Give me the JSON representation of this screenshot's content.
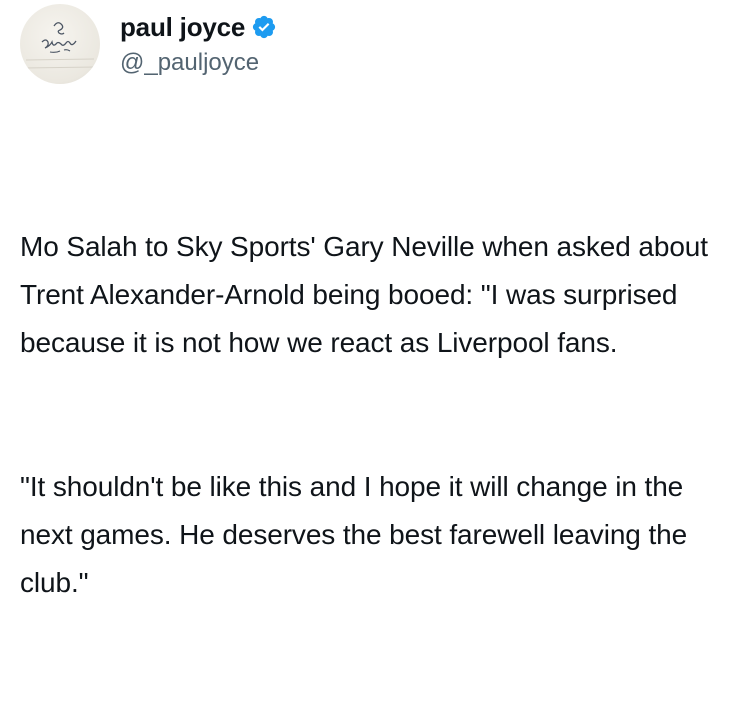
{
  "author": {
    "display_name": "paul joyce",
    "handle": "@_pauljoyce",
    "verified": true,
    "avatar_icon": "signature-avatar",
    "verified_icon": "verified-badge-icon",
    "verified_color": "#1d9bf0"
  },
  "tweet": {
    "paragraphs": [
      "Mo Salah to Sky Sports' Gary Neville when asked about Trent Alexander-Arnold being booed: \"I was surprised because it is not how we react as Liverpool fans.",
      "\"It shouldn't be like this and I hope it will change in the next games. He deserves the best farewell leaving the club.\""
    ]
  }
}
